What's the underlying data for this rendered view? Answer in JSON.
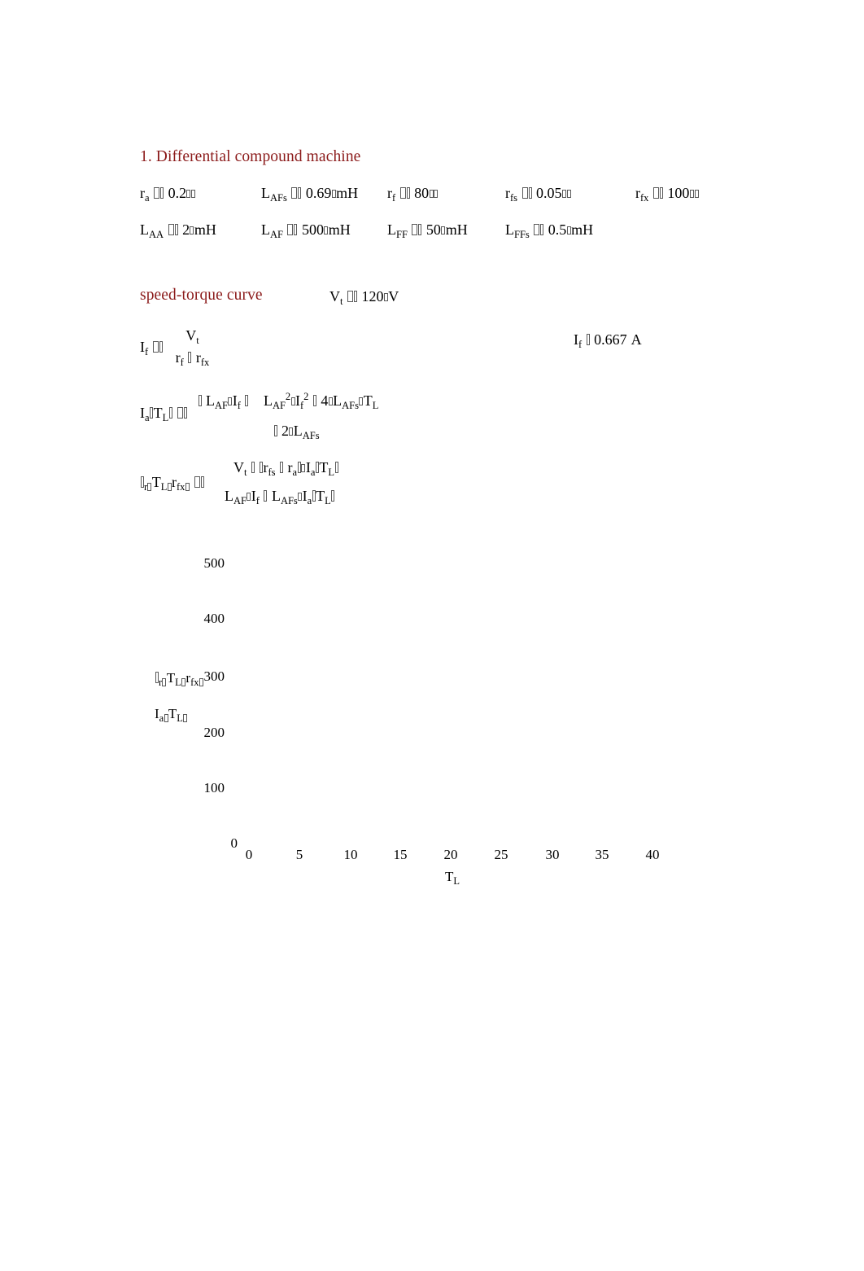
{
  "document": {
    "section_title": "1. Differential compound machine",
    "subsection_title": "speed-torque curve"
  },
  "parameters": {
    "row1": [
      {
        "name": "r",
        "subscript": "a",
        "value": "0.2",
        "unit": "Ω"
      },
      {
        "name": "L",
        "subscript": "AFs",
        "value": "0.69",
        "unit": "mH"
      },
      {
        "name": "r",
        "subscript": "f",
        "value": "80",
        "unit": "Ω"
      },
      {
        "name": "r",
        "subscript": "fs",
        "value": "0.05",
        "unit": "Ω"
      },
      {
        "name": "r",
        "subscript": "fx",
        "value": "100",
        "unit": "Ω"
      }
    ],
    "row2": [
      {
        "name": "L",
        "subscript": "AA",
        "value": "2",
        "unit": "mH"
      },
      {
        "name": "L",
        "subscript": "AF",
        "value": "500",
        "unit": "mH"
      },
      {
        "name": "L",
        "subscript": "FF",
        "value": "50",
        "unit": "mH"
      },
      {
        "name": "L",
        "subscript": "FFs",
        "value": "0.5",
        "unit": "mH"
      }
    ],
    "terminal_voltage": {
      "name": "V",
      "subscript": "t",
      "value": "120",
      "unit": "V"
    }
  },
  "equations": {
    "field_current_def": {
      "lhs_name": "I",
      "lhs_sub": "f",
      "numerator_name": "V",
      "numerator_sub": "t",
      "den_left_name": "r",
      "den_left_sub": "f",
      "den_right_name": "r",
      "den_right_sub": "fx"
    },
    "field_current_result": {
      "name": "I",
      "subscript": "f",
      "value": "0.667",
      "unit": "A"
    },
    "armature_current": {
      "lhs": "I",
      "lhs_sub": "a",
      "arg": "T",
      "arg_sub": "L",
      "num_term1_name": "L",
      "num_term1_sub": "AF",
      "num_term1b_name": "I",
      "num_term1b_sub": "f",
      "num_rad1_name": "L",
      "num_rad1_sub": "AF",
      "num_rad1_exp": "2",
      "num_rad2_name": "I",
      "num_rad2_sub": "f",
      "num_rad2_exp": "2",
      "num_rad3_coef": "4",
      "num_rad3_name": "L",
      "num_rad3_sub": "AFs",
      "num_rad4_name": "T",
      "num_rad4_sub": "L",
      "den_coef": "2",
      "den_name": "L",
      "den_sub": "AFs"
    },
    "speed": {
      "lhs_sub": "r",
      "arg1": "T",
      "arg1_sub": "L",
      "arg2": "r",
      "arg2_sub": "fx",
      "num_v_name": "V",
      "num_v_sub": "t",
      "num_rfs_name": "r",
      "num_rfs_sub": "fs",
      "num_ra_name": "r",
      "num_ra_sub": "a",
      "num_ia_name": "I",
      "num_ia_sub": "a",
      "num_tl_name": "T",
      "num_tl_sub": "L",
      "den_laf_name": "L",
      "den_laf_sub": "AF",
      "den_if_name": "I",
      "den_if_sub": "f",
      "den_lafs_name": "L",
      "den_lafs_sub": "AFs",
      "den_ia_name": "I",
      "den_ia_sub": "a",
      "den_tl_name": "T",
      "den_tl_sub": "L"
    }
  },
  "chart_data": {
    "type": "line",
    "title": "",
    "xlabel": "T_L",
    "ylabel": "",
    "x_ticks": [
      "0",
      "5",
      "10",
      "15",
      "20",
      "25",
      "30",
      "35",
      "40"
    ],
    "y_ticks": [
      "500",
      "400",
      "300",
      "200",
      "100",
      "0"
    ],
    "xlim": [
      0,
      40
    ],
    "ylim": [
      0,
      500
    ],
    "grid": false,
    "legend_position": "left-axis",
    "series": [
      {
        "name": "ω_r(T_L, r_fx)",
        "values": []
      },
      {
        "name": "I_a(T_L)",
        "values": []
      }
    ],
    "legend_entries": [
      {
        "base": "",
        "sub": "r",
        "arg1": "T",
        "arg1_sub": "L",
        "arg2": "r",
        "arg2_sub": "fx"
      },
      {
        "base": "I",
        "sub": "a",
        "arg1": "T",
        "arg1_sub": "L"
      }
    ],
    "axis_title": {
      "base": "T",
      "sub": "L"
    }
  }
}
